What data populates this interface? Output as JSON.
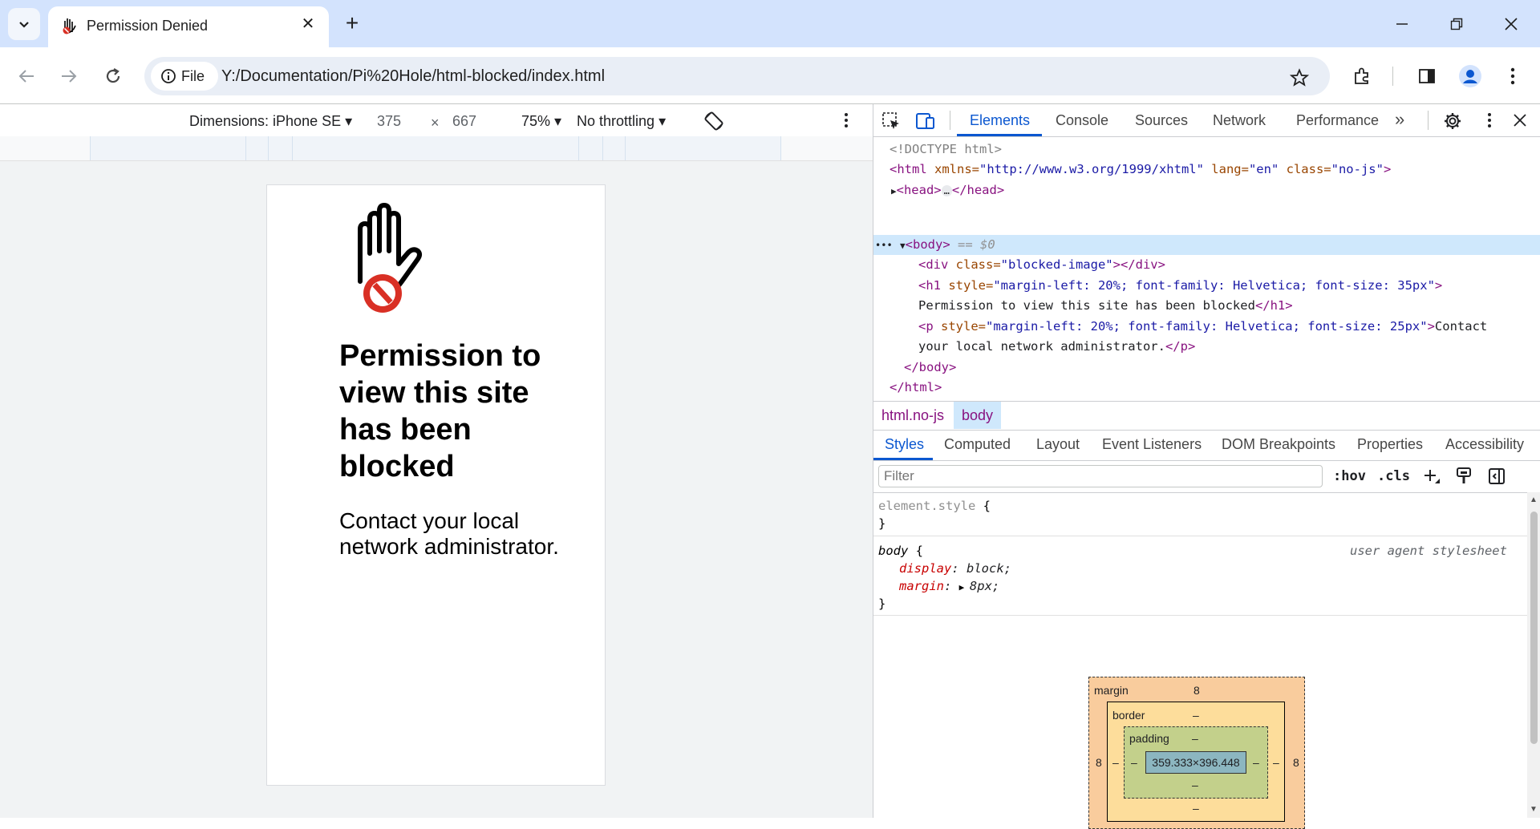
{
  "browser": {
    "tab_title": "Permission Denied",
    "site_chip_label": "File",
    "url": "Y:/Documentation/Pi%20Hole/html-blocked/index.html"
  },
  "device_toolbar": {
    "dimensions_label": "Dimensions: iPhone SE",
    "width": "375",
    "times": "×",
    "height": "667",
    "zoom": "75%",
    "throttling": "No throttling"
  },
  "page": {
    "heading": "Permission to view this site has been blocked",
    "message": "Contact your local network administrator."
  },
  "devtools": {
    "tabs": [
      "Elements",
      "Console",
      "Sources",
      "Network",
      "Performance"
    ],
    "more_tabs": "»",
    "dom": {
      "doctype": "<!DOCTYPE html>",
      "html_open_tag": "<html",
      "html_attr1_name": " xmlns=",
      "html_attr1_value": "\"http://www.w3.org/1999/xhtml\"",
      "html_attr2_name": " lang=",
      "html_attr2_value": "\"en\"",
      "html_attr3_name": " class=",
      "html_attr3_value": "\"no-js\"",
      "head_open": "<head>",
      "ellipsis": "…",
      "head_close": "</head>",
      "body_tag": "<body>",
      "body_marker": "== $0",
      "div_open": "<div",
      "div_attr": " class=",
      "div_value": "\"blocked-image\"",
      "div_close": "></div>",
      "h1_open": "<h1",
      "h1_attr": " style=",
      "h1_value": "\"margin-left: 20%; font-family: Helvetica; font-size: 35px\"",
      "h1_text": "Permission to view this site has been blocked",
      "h1_close": "</h1>",
      "p_open": "<p",
      "p_attr": " style=",
      "p_value": "\"margin-left: 20%; font-family: Helvetica; font-size: 25px\"",
      "p_text_1": "Contact",
      "p_text_2": "your local network administrator.",
      "p_close": "</p>",
      "body_close": "</body>",
      "html_close": "</html>"
    },
    "breadcrumbs": [
      "html.no-js",
      "body"
    ],
    "sub_tabs": [
      "Styles",
      "Computed",
      "Layout",
      "Event Listeners",
      "DOM Breakpoints",
      "Properties",
      "Accessibility"
    ],
    "filter_placeholder": "Filter",
    "hov": ":hov",
    "cls": ".cls",
    "styles": {
      "element_selector": "element.style",
      "body_selector": "body",
      "open_brace": " {",
      "close_brace": "}",
      "source": "user agent stylesheet",
      "rules": [
        {
          "prop": "display",
          "value": "block;"
        },
        {
          "prop": "margin",
          "value": "8px;"
        }
      ]
    },
    "box_model": {
      "margin_label": "margin",
      "margin_top": "8",
      "margin_left": "8",
      "margin_right": "8",
      "border_label": "border",
      "border_value": "–",
      "padding_label": "padding",
      "padding_value": "–",
      "content": "359.333×396.448"
    }
  }
}
